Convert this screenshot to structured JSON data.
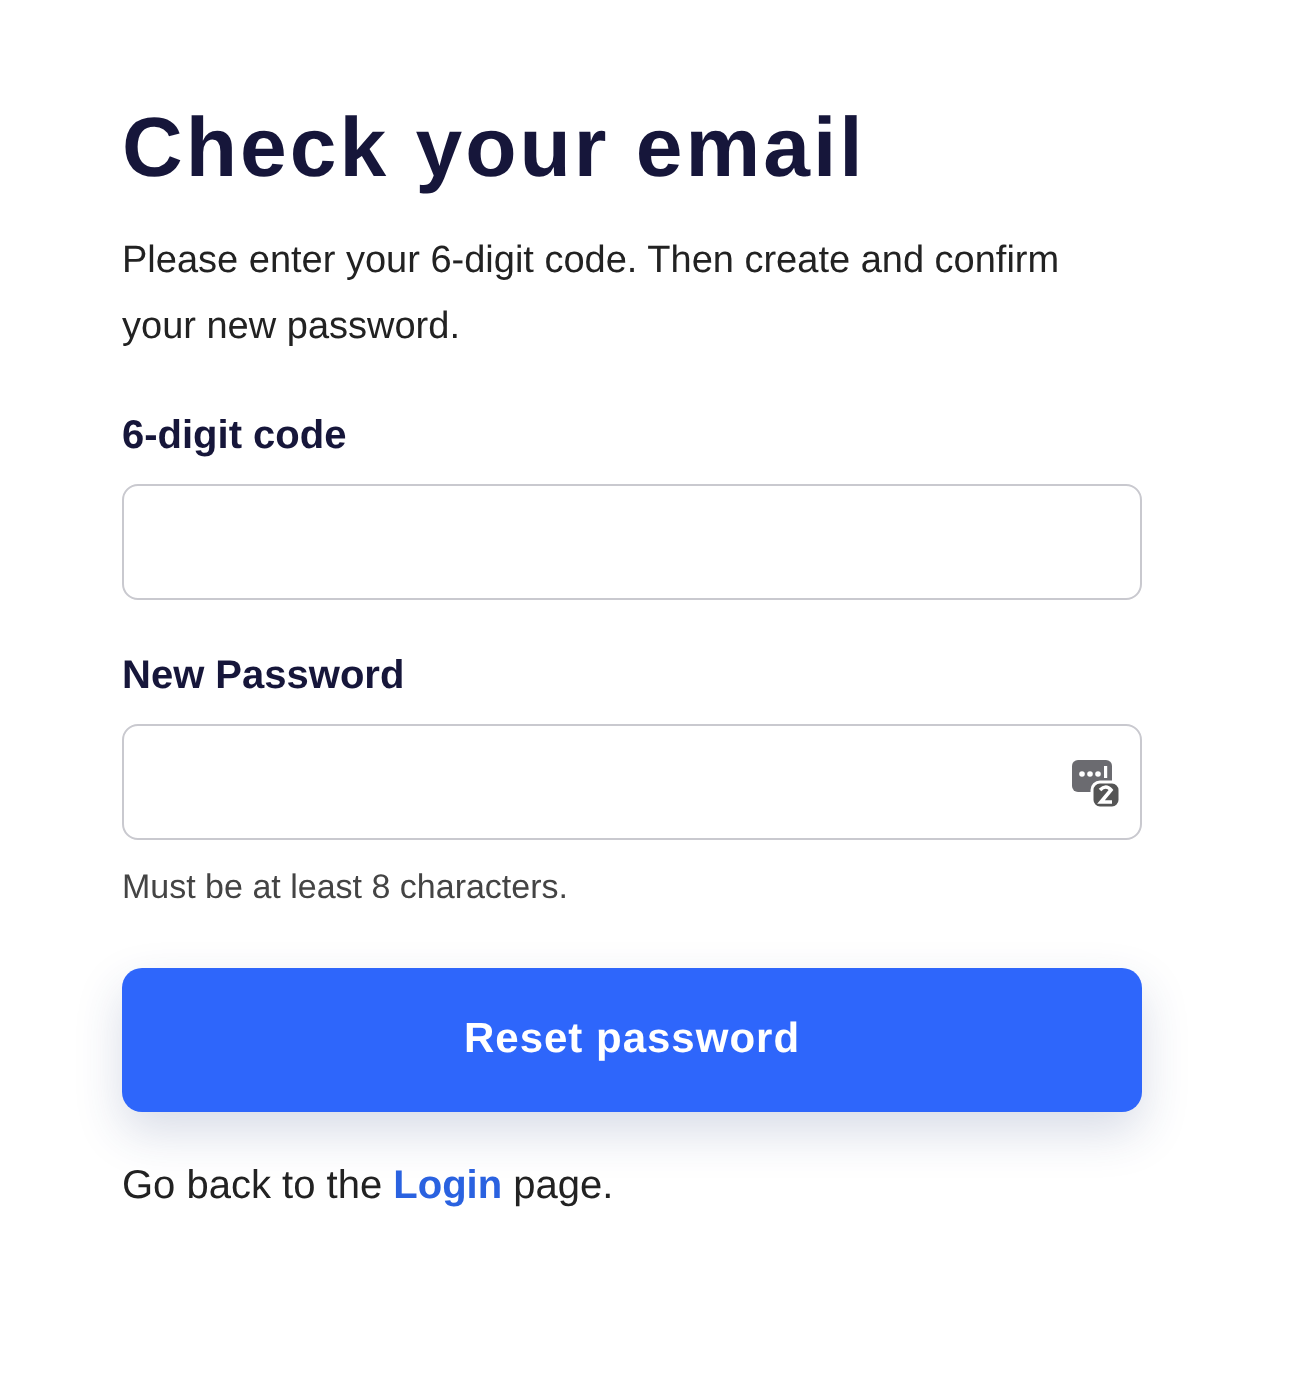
{
  "title": "Check your email",
  "description": "Please enter your 6-digit code. Then create and confirm your new password.",
  "fields": [
    {
      "label": "6-digit code",
      "kind": "text"
    },
    {
      "label": "New Password",
      "kind": "password",
      "hint": "Must be at least 8 characters."
    }
  ],
  "submit_button": "Reset password",
  "footer": {
    "before": "Go back to the ",
    "link": "Login",
    "after": " page."
  }
}
